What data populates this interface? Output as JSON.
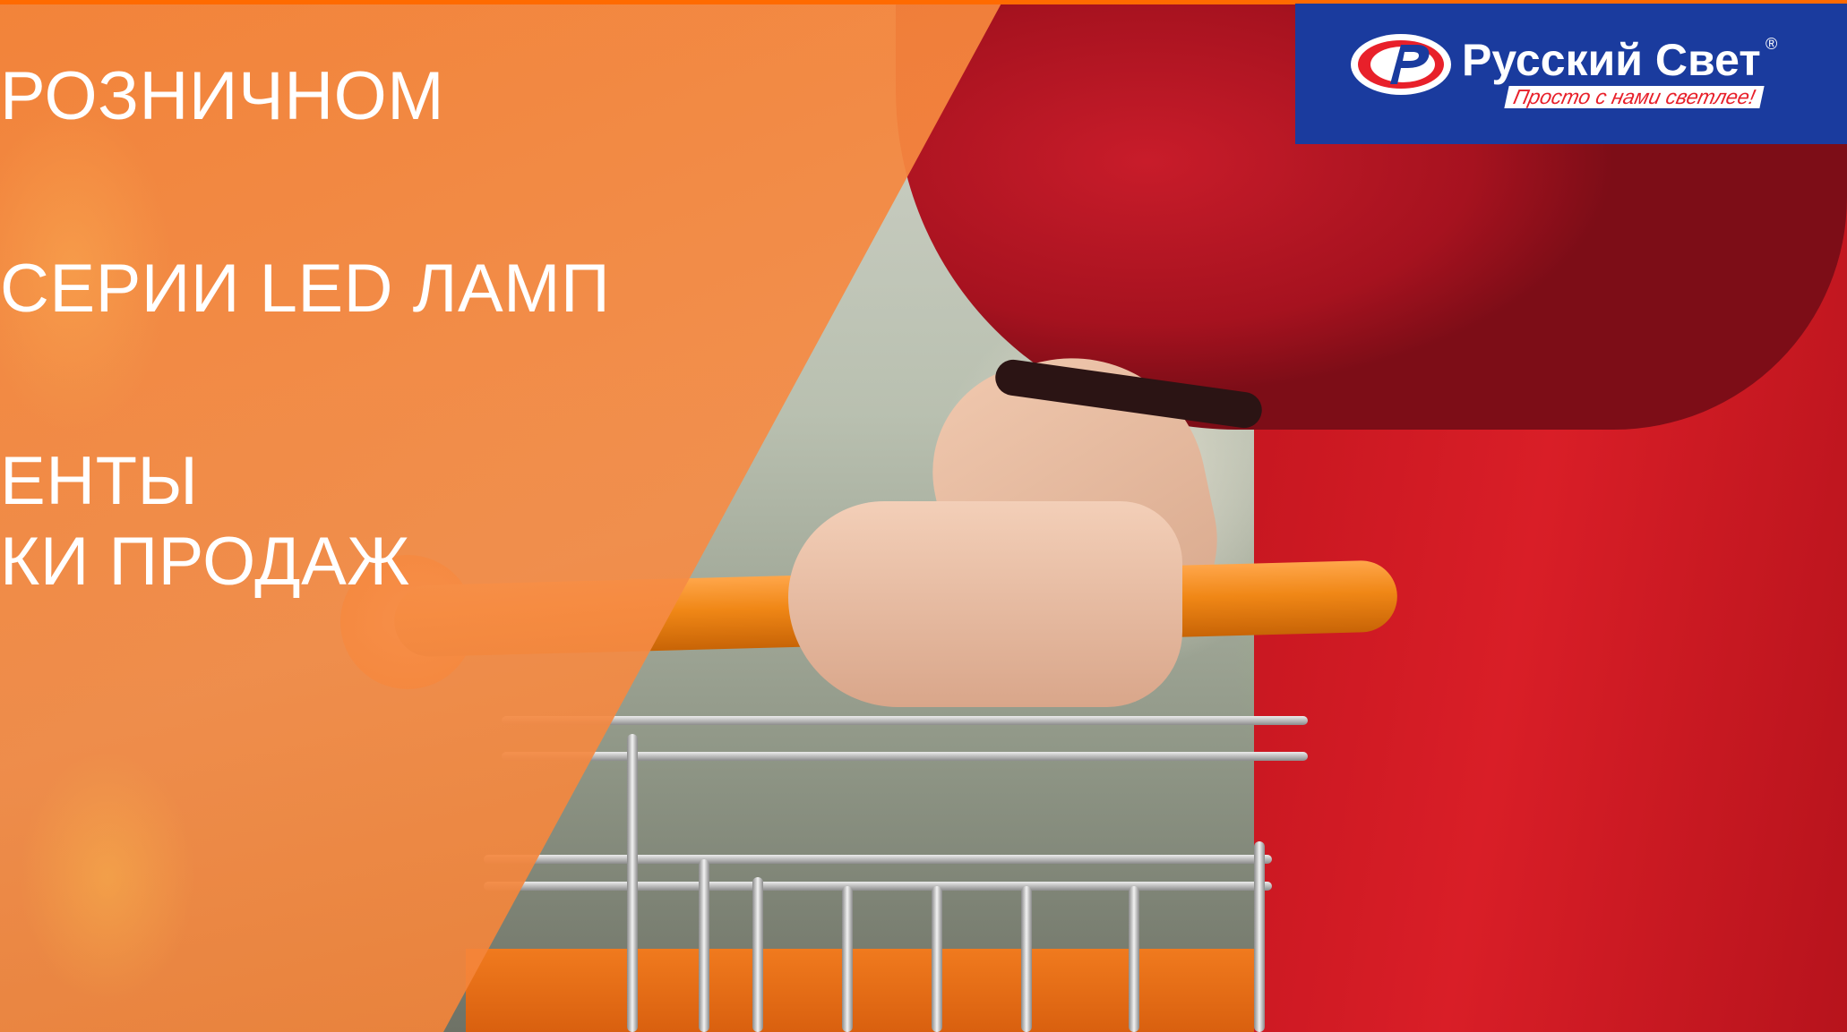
{
  "slide": {
    "headlines": [
      "РОЗНИЧНОМ",
      "СЕРИИ LED ЛАМП",
      "ЕНТЫ",
      "КИ ПРОДАЖ"
    ]
  },
  "logo": {
    "brand": "Русский Свет",
    "registered_mark": "®",
    "slogan": "Просто с нами светлее!",
    "icon": "rs-logo-icon"
  },
  "colors": {
    "accent_orange": "#f48034",
    "logo_blue": "#1a3b9e",
    "logo_red": "#e8202a"
  }
}
